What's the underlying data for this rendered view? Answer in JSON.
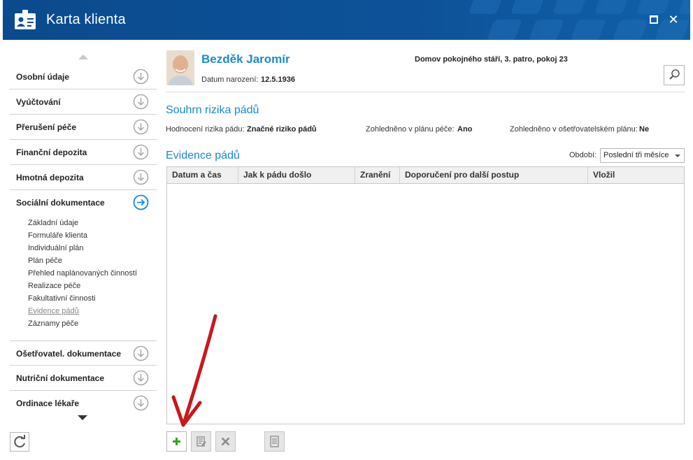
{
  "window": {
    "title": "Karta klienta",
    "colors": {
      "titlebar": "#0e4f93",
      "accent": "#1a8ad4"
    }
  },
  "nav": {
    "items": [
      {
        "label": "Osobní údaje",
        "icon": "arrow-down-circle-icon"
      },
      {
        "label": "Vyúčtování",
        "icon": "arrow-down-circle-icon"
      },
      {
        "label": "Přerušení péče",
        "icon": "arrow-down-circle-icon"
      },
      {
        "label": "Finanční depozita",
        "icon": "arrow-down-circle-icon"
      },
      {
        "label": "Hmotná depozita",
        "icon": "arrow-down-circle-icon"
      },
      {
        "label": "Sociální dokumentace",
        "icon": "arrow-right-circle-icon",
        "expanded": true
      },
      {
        "label": "Ošetřovatel. dokumentace",
        "icon": "arrow-down-circle-icon"
      },
      {
        "label": "Nutriční dokumentace",
        "icon": "arrow-down-circle-icon"
      },
      {
        "label": "Ordinace lékaře",
        "icon": "arrow-down-circle-icon"
      }
    ],
    "subitems": [
      "Základní údaje",
      "Formuláře klienta",
      "Individuální plán",
      "Plán péče",
      "Přehled naplánovaných činností",
      "Realizace péče",
      "Fakultativní činnosti",
      "Evidence pádů",
      "Záznamy péče"
    ],
    "active_subitem": "Evidence pádů"
  },
  "client": {
    "name": "Bezděk Jaromír",
    "dob_label": "Datum narození:",
    "dob_value": "12.5.1936",
    "residence": "Domov pokojného stáří, 3. patro, pokoj 23"
  },
  "summary": {
    "title": "Souhrn rizika pádů",
    "risk_label": "Hodnocení rizika pádu:",
    "risk_value": "Značné riziko pádů",
    "plan_label": "Zohledněno v plánu péče:",
    "plan_value": "Ano",
    "nursing_label": "Zohledněno v ošetřovatelském plánu:",
    "nursing_value": "Ne"
  },
  "evidence": {
    "title": "Evidence pádů",
    "period_label": "Období:",
    "period_value": "Poslední tři měsíce",
    "columns": [
      "Datum a čas",
      "Jak k pádu došlo",
      "Zranění",
      "Doporučení pro další postup",
      "Vložil"
    ],
    "rows": []
  },
  "toolbar": {
    "buttons": [
      {
        "name": "add-button",
        "icon": "plus-icon",
        "enabled": true
      },
      {
        "name": "edit-button",
        "icon": "edit-document-icon",
        "enabled": false
      },
      {
        "name": "delete-button",
        "icon": "delete-x-icon",
        "enabled": false
      },
      {
        "name": "report-button",
        "icon": "document-icon",
        "enabled": false
      }
    ]
  }
}
